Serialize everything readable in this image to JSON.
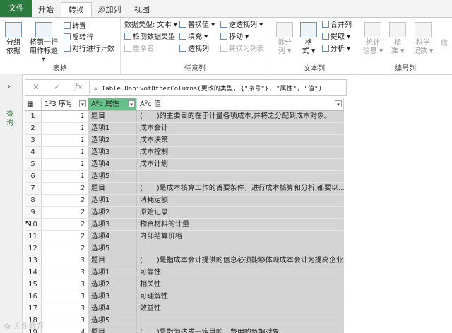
{
  "tabs": [
    "文件",
    "开始",
    "转换",
    "添加列",
    "视图"
  ],
  "ribbon": {
    "table_group": {
      "label": "表格",
      "group_by": "分组\n依据",
      "first_row": "将第一行\n用作标题 ▾",
      "transpose": "转置",
      "reverse": "反转行",
      "count_rows": "对行进行计数"
    },
    "any_column": {
      "label": "任意列",
      "data_type": "数据类型: 文本 ▾",
      "detect_type": "检测数据类型",
      "rename": "重命名",
      "replace": "替换值 ▾",
      "fill": "填充 ▾",
      "pivot": "透视列",
      "unpivot": "逆透视列 ▾",
      "move": "移动 ▾",
      "to_list": "转换为列表"
    },
    "text_column": {
      "label": "文本列",
      "split": "拆分\n列 ▾",
      "format": "格\n式 ▾",
      "merge": "合并列",
      "extract": "提取 ▾",
      "parse": "分析 ▾"
    },
    "number_column": {
      "label": "编号列",
      "stats": "统计\n信息 ▾",
      "standard": "标\n准 ▾",
      "scientific": "科学\n记数 ▾",
      "info": "信"
    }
  },
  "left_pane": {
    "label": "查询"
  },
  "formula": "= Table.UnpivotOtherColumns(更改的类型, {\"序号\"}, \"属性\", \"值\")",
  "table": {
    "columns": [
      {
        "type": "1²3",
        "name": "序号"
      },
      {
        "type": "Aᴮc",
        "name": "属性"
      },
      {
        "type": "Aᴮc",
        "name": "值"
      }
    ],
    "rows": [
      [
        "1",
        "1",
        "题目",
        "(　　)的主要目的在于计量各项成本,并将之分配到成本对象。"
      ],
      [
        "2",
        "1",
        "选项1",
        "成本会计"
      ],
      [
        "3",
        "1",
        "选项2",
        "成本决策"
      ],
      [
        "4",
        "1",
        "选项3",
        "成本控制"
      ],
      [
        "5",
        "1",
        "选项4",
        "成本计划"
      ],
      [
        "6",
        "1",
        "选项5",
        ""
      ],
      [
        "7",
        "2",
        "题目",
        "(　　)是成本核算工作的首要条件，进行成本核算和分析,都要以..."
      ],
      [
        "8",
        "2",
        "选项1",
        "消耗定额"
      ],
      [
        "9",
        "2",
        "选项2",
        "原始记录"
      ],
      [
        "10",
        "2",
        "选项3",
        "物资材料的计量"
      ],
      [
        "11",
        "2",
        "选项4",
        "内部结算价格"
      ],
      [
        "12",
        "2",
        "选项5",
        ""
      ],
      [
        "13",
        "3",
        "题目",
        "(　　)是指成本会计提供的信息必须能够体现成本会计为提高企业..."
      ],
      [
        "14",
        "3",
        "选项1",
        "可靠性"
      ],
      [
        "15",
        "3",
        "选项2",
        "相关性"
      ],
      [
        "16",
        "3",
        "选项3",
        "可理解性"
      ],
      [
        "17",
        "3",
        "选项4",
        "效益性"
      ],
      [
        "18",
        "3",
        "选项5",
        ""
      ],
      [
        "19",
        "4",
        "题目",
        "(　　)是指为达成一定目的，费用的负担对象..."
      ]
    ]
  }
}
